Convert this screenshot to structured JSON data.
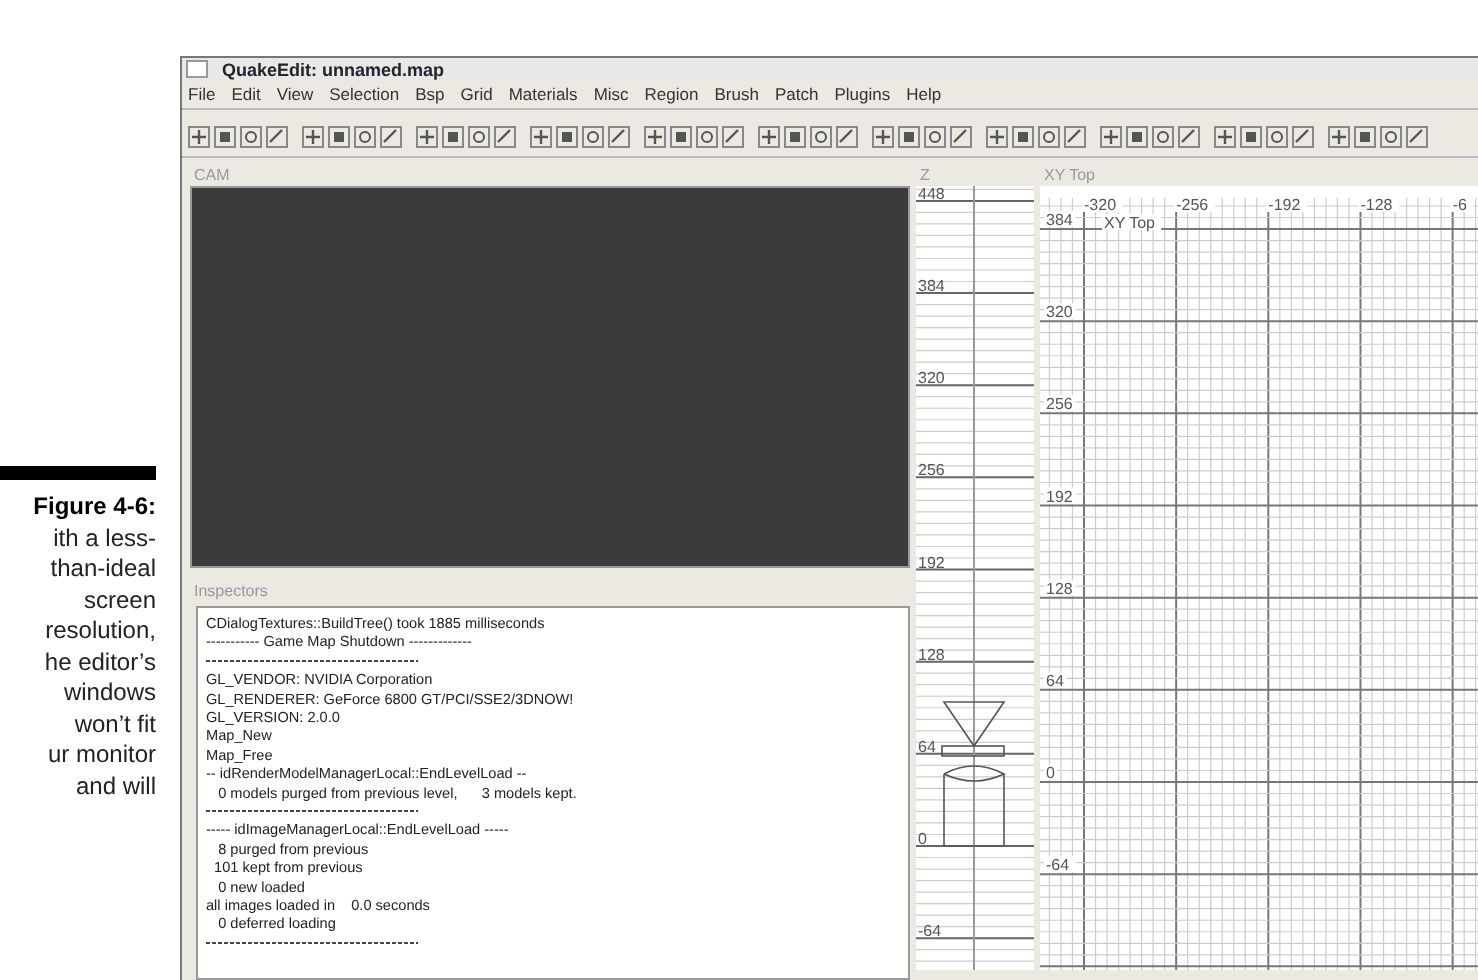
{
  "caption": {
    "label": "Figure 4-6:",
    "lines": [
      "ith a less-",
      "than-ideal",
      "screen",
      "resolution,",
      "he editor’s",
      "windows",
      "won’t fit",
      "ur monitor",
      "and will"
    ]
  },
  "window": {
    "title": "QuakeEdit: unnamed.map"
  },
  "menu": [
    "File",
    "Edit",
    "View",
    "Selection",
    "Bsp",
    "Grid",
    "Materials",
    "Misc",
    "Region",
    "Brush",
    "Patch",
    "Plugins",
    "Help"
  ],
  "cam": {
    "title": "CAM"
  },
  "inspectors": {
    "title": "Inspectors",
    "log": [
      {
        "kind": "text",
        "text": "CDialogTextures::BuildTree() took 1885 milliseconds"
      },
      {
        "kind": "text",
        "text": "----------- Game Map Shutdown -------------"
      },
      {
        "kind": "rule"
      },
      {
        "kind": "text",
        "text": "GL_VENDOR: NVIDIA Corporation"
      },
      {
        "kind": "text",
        "text": "GL_RENDERER: GeForce 6800 GT/PCI/SSE2/3DNOW!"
      },
      {
        "kind": "text",
        "text": "GL_VERSION: 2.0.0"
      },
      {
        "kind": "text",
        "text": "Map_New"
      },
      {
        "kind": "text",
        "text": "Map_Free"
      },
      {
        "kind": "text",
        "text": "-- idRenderModelManagerLocal::EndLevelLoad --"
      },
      {
        "kind": "text",
        "text": "   0 models purged from previous level,      3 models kept."
      },
      {
        "kind": "rule"
      },
      {
        "kind": "text",
        "text": "----- idImageManagerLocal::EndLevelLoad -----"
      },
      {
        "kind": "text",
        "text": "   8 purged from previous"
      },
      {
        "kind": "text",
        "text": "  101 kept from previous"
      },
      {
        "kind": "text",
        "text": "   0 new loaded"
      },
      {
        "kind": "text",
        "text": "all images loaded in    0.0 seconds"
      },
      {
        "kind": "text",
        "text": "   0 deferred loading"
      },
      {
        "kind": "rule"
      }
    ]
  },
  "z_view": {
    "title": "Z",
    "labels": [
      "448",
      "384",
      "320",
      "256",
      "192",
      "128",
      "64",
      "0",
      "-64"
    ]
  },
  "xy_view": {
    "title": "XY Top",
    "overlay_label": "XY Top",
    "x_labels": [
      "-320",
      "-256",
      "-192",
      "-128",
      "-6"
    ],
    "y_labels": [
      "384",
      "320",
      "256",
      "192",
      "128",
      "64",
      "0",
      "-64"
    ]
  }
}
